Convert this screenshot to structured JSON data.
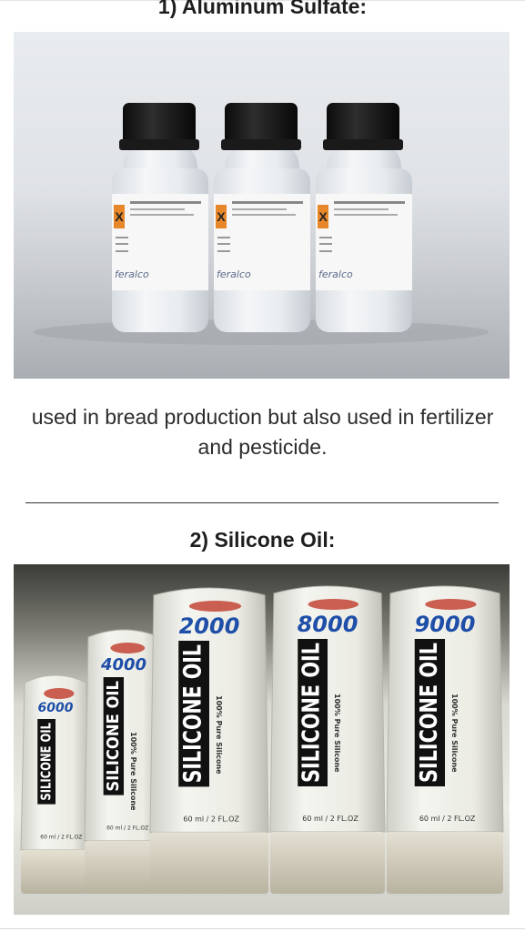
{
  "section1": {
    "heading": "1) Aluminum Sulfate:",
    "image": {
      "bottle_count": 3,
      "label_brand": "feralco"
    }
  },
  "caption": "used in bread production but also used in fertilizer and pesticide.",
  "section2": {
    "heading": "2) Silicone Oil:",
    "image": {
      "tubes": [
        {
          "number": "6000",
          "product": "SILICONE OIL"
        },
        {
          "number": "4000",
          "product": "SILICONE OIL"
        },
        {
          "number": "2000",
          "product": "SILICONE OIL"
        },
        {
          "number": "8000",
          "product": "SILICONE OIL"
        },
        {
          "number": "9000",
          "product": "SILICONE OIL"
        }
      ],
      "tube_tag": "100% Pure Silicone",
      "tube_volume": "60 ml / 2 FL.OZ"
    }
  },
  "colors": {
    "heading": "#1e1e1e",
    "text": "#2c2c2c",
    "bottle_cap": "#151515",
    "tube_number": "#1f4fa8",
    "tube_band": "#111111",
    "hazard_orange": "#e8862a"
  }
}
